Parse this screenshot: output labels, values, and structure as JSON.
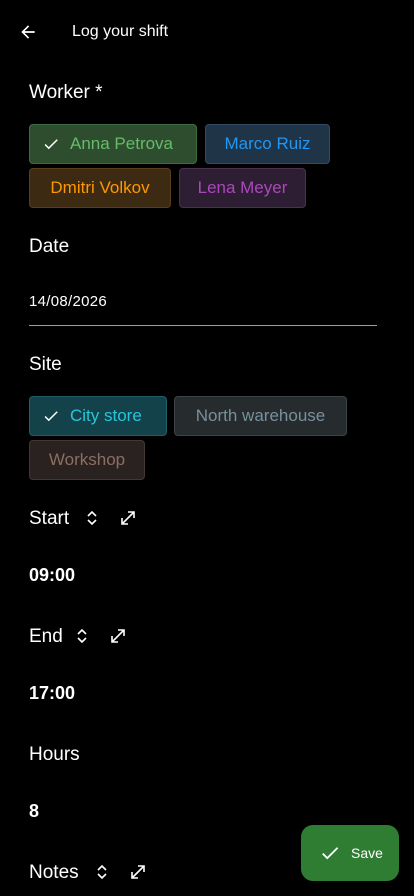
{
  "header": {
    "title": "Log your shift"
  },
  "worker": {
    "label": "Worker *",
    "chips": [
      {
        "name": "Anna Petrova",
        "selected": true,
        "color": "#43a047"
      },
      {
        "name": "Marco Ruiz",
        "selected": false,
        "color": "#2196f3"
      },
      {
        "name": "Dmitri Volkov",
        "selected": false,
        "color": "#ff9800"
      },
      {
        "name": "Lena Meyer",
        "selected": false,
        "color": "#9c27b0"
      }
    ]
  },
  "date": {
    "label": "Date",
    "value": "14/08/2026"
  },
  "site": {
    "label": "Site",
    "chips": [
      {
        "name": "City store",
        "selected": true,
        "color": "#00bcd4"
      },
      {
        "name": "North warehouse",
        "selected": false,
        "color": "#78909c"
      },
      {
        "name": "Workshop",
        "selected": false,
        "color": "#8d6e63"
      }
    ]
  },
  "start": {
    "label": "Start",
    "value": "09:00"
  },
  "end": {
    "label": "End",
    "value": "17:00"
  },
  "hours": {
    "label": "Hours",
    "value": "8"
  },
  "notes": {
    "label": "Notes"
  },
  "fab": {
    "label": "Save",
    "color": "#2e7d32"
  },
  "icons": {
    "back": "arrow-left-icon",
    "check": "check-icon",
    "sort": "unfold-icon",
    "expand": "expand-icon"
  }
}
